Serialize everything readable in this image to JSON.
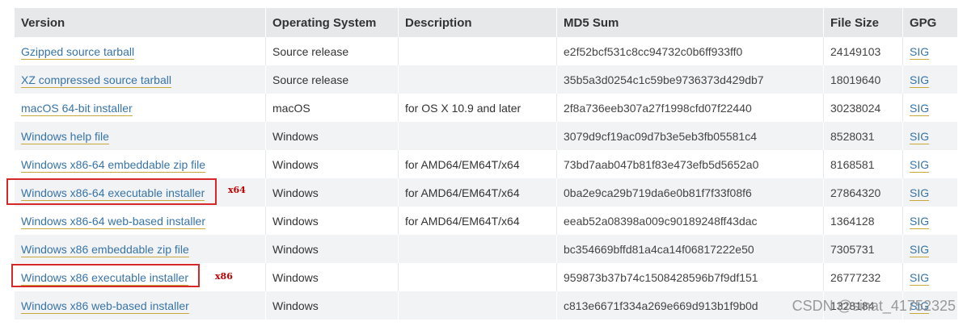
{
  "table": {
    "headers": {
      "version": "Version",
      "os": "Operating System",
      "description": "Description",
      "md5": "MD5 Sum",
      "size": "File Size",
      "gpg": "GPG"
    },
    "rows": [
      {
        "version": "Gzipped source tarball",
        "os": "Source release",
        "description": "",
        "md5": "e2f52bcf531c8cc94732c0b6ff933ff0",
        "size": "24149103",
        "gpg": "SIG"
      },
      {
        "version": "XZ compressed source tarball",
        "os": "Source release",
        "description": "",
        "md5": "35b5a3d0254c1c59be9736373d429db7",
        "size": "18019640",
        "gpg": "SIG"
      },
      {
        "version": "macOS 64-bit installer",
        "os": "macOS",
        "description": "for OS X 10.9 and later",
        "md5": "2f8a736eeb307a27f1998cfd07f22440",
        "size": "30238024",
        "gpg": "SIG"
      },
      {
        "version": "Windows help file",
        "os": "Windows",
        "description": "",
        "md5": "3079d9cf19ac09d7b3e5eb3fb05581c4",
        "size": "8528031",
        "gpg": "SIG"
      },
      {
        "version": "Windows x86-64 embeddable zip file",
        "os": "Windows",
        "description": "for AMD64/EM64T/x64",
        "md5": "73bd7aab047b81f83e473efb5d5652a0",
        "size": "8168581",
        "gpg": "SIG"
      },
      {
        "version": "Windows x86-64 executable installer",
        "os": "Windows",
        "description": "for AMD64/EM64T/x64",
        "md5": "0ba2e9ca29b719da6e0b81f7f33f08f6",
        "size": "27864320",
        "gpg": "SIG"
      },
      {
        "version": "Windows x86-64 web-based installer",
        "os": "Windows",
        "description": "for AMD64/EM64T/x64",
        "md5": "eeab52a08398a009c90189248ff43dac",
        "size": "1364128",
        "gpg": "SIG"
      },
      {
        "version": "Windows x86 embeddable zip file",
        "os": "Windows",
        "description": "",
        "md5": "bc354669bffd81a4ca14f06817222e50",
        "size": "7305731",
        "gpg": "SIG"
      },
      {
        "version": "Windows x86 executable installer",
        "os": "Windows",
        "description": "",
        "md5": "959873b37b74c1508428596b7f9df151",
        "size": "26777232",
        "gpg": "SIG"
      },
      {
        "version": "Windows x86 web-based installer",
        "os": "Windows",
        "description": "",
        "md5": "c813e6671f334a269e669d913b1f9b0d",
        "size": "1328184",
        "gpg": "SIG"
      }
    ]
  },
  "annotations": {
    "x64_note": "x64",
    "x86_note": "x86",
    "highlight_color": "#d62828"
  },
  "watermark": "CSDN @sinat_41752325",
  "colors": {
    "link": "#3774a8",
    "header_bg": "#e6e8ea",
    "stripe_bg": "#f2f3f4"
  }
}
